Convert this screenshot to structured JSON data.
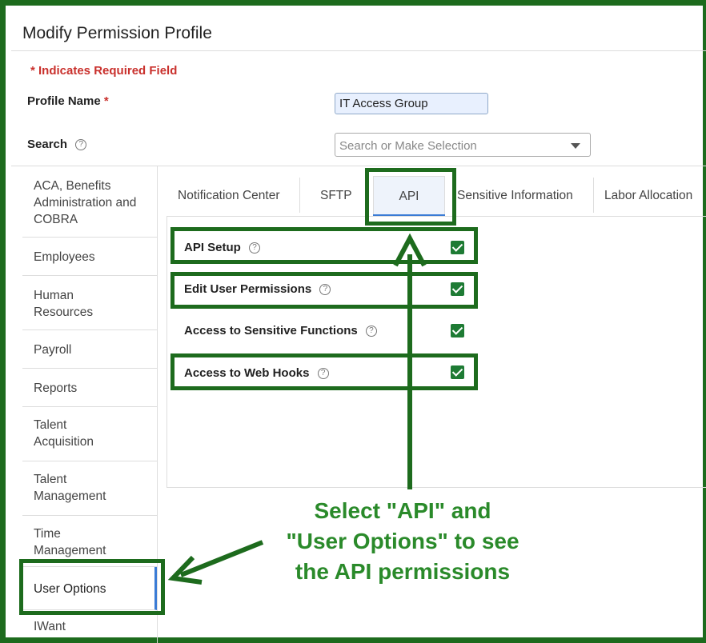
{
  "page": {
    "title": "Modify Permission Profile"
  },
  "form": {
    "required_note": "* Indicates Required Field",
    "profile_name_label": "Profile Name",
    "required_star": "*",
    "profile_name_value": "IT Access Group",
    "search_label": "Search",
    "search_placeholder": "Search or Make Selection"
  },
  "sidebar": {
    "items": [
      {
        "label": "ACA, Benefits Administration and COBRA"
      },
      {
        "label": "Employees"
      },
      {
        "label": "Human Resources"
      },
      {
        "label": "Payroll"
      },
      {
        "label": "Reports"
      },
      {
        "label": "Talent Acquisition"
      },
      {
        "label": "Talent Management"
      },
      {
        "label": "Time Management"
      },
      {
        "label": "User Options",
        "selected": true
      },
      {
        "label": "IWant"
      }
    ]
  },
  "tabs": [
    {
      "label": "Notification Center"
    },
    {
      "label": "SFTP"
    },
    {
      "label": "API",
      "active": true
    },
    {
      "label": "Sensitive Information"
    },
    {
      "label": "Labor Allocation"
    }
  ],
  "permissions": [
    {
      "label": "API Setup",
      "checked": true
    },
    {
      "label": "Edit User Permissions",
      "checked": true
    },
    {
      "label": "Access to Sensitive Functions",
      "checked": true
    },
    {
      "label": "Access to Web Hooks",
      "checked": true
    }
  ],
  "annotation": {
    "callout_line1": "Select \"API\" and",
    "callout_line2": "\"User Options\" to see",
    "callout_line3": "the API permissions"
  },
  "colors": {
    "highlight": "#1d6b1d",
    "callout_text": "#2a8a2a",
    "required": "#c9302c",
    "checkbox": "#1e7b34",
    "active_tab": "#3a7bd5"
  },
  "icons": {
    "help": "help-circle-icon",
    "dropdown": "chevron-down-icon",
    "check": "checkmark-icon"
  }
}
